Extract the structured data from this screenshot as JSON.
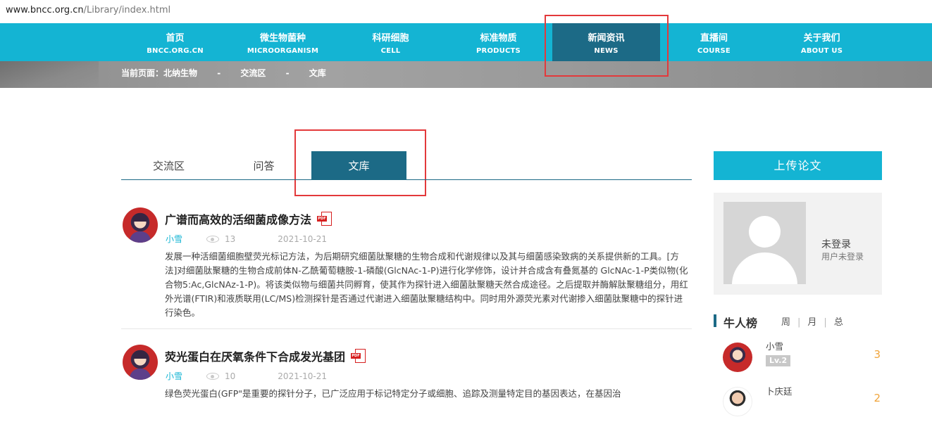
{
  "browser": {
    "url_host": "www.bncc.org.cn",
    "url_path": "/Library/index.html"
  },
  "nav": [
    {
      "cn": "首页",
      "en": "BNCC.ORG.CN"
    },
    {
      "cn": "微生物菌种",
      "en": "MICROORGANISM"
    },
    {
      "cn": "科研细胞",
      "en": "CELL"
    },
    {
      "cn": "标准物质",
      "en": "PRODUCTS"
    },
    {
      "cn": "新闻资讯",
      "en": "NEWS"
    },
    {
      "cn": "直播间",
      "en": "COURSE"
    },
    {
      "cn": "关于我们",
      "en": "ABOUT US"
    }
  ],
  "breadcrumb": {
    "label": "当前页面：北纳生物",
    "sep": "-",
    "item1": "交流区",
    "item2": "文库"
  },
  "tabs": [
    "交流区",
    "问答",
    "文库"
  ],
  "articles": [
    {
      "title": "广谱而高效的活细菌成像方法",
      "file_icon": "PDF",
      "author": "小雪",
      "views": "13",
      "date": "2021-10-21",
      "summary": "发展一种活细菌细胞壁荧光标记方法，为后期研究细菌肽聚糖的生物合成和代谢规律以及其与细菌感染致病的关系提供新的工具。[方法]对细菌肽聚糖的生物合成前体N-乙酰葡萄糖胺-1-磷酸(GlcNAc-1-P)进行化学修饰，设计并合成含有叠氮基的 GlcNAc-1-P类似物(化合物5:Ac,GlcNAz-1-P)。将该类似物与细菌共同孵育，使其作为探针进入细菌肽聚糖天然合成途径。之后提取并酶解肽聚糖组分，用红外光谱(FTIR)和液质联用(LC/MS)检测探针是否通过代谢进入细菌肽聚糖结构中。同时用外源荧光素对代谢掺入细菌肽聚糖中的探针进行染色。"
    },
    {
      "title": "荧光蛋白在厌氧条件下合成发光基团",
      "file_icon": "PDF",
      "author": "小雪",
      "views": "10",
      "date": "2021-10-21",
      "summary": "绿色荧光蛋白(GFP\"是重要的探针分子，已广泛应用于标记特定分子或细胞、追踪及测量特定目的基因表达，在基因治"
    }
  ],
  "sidebar": {
    "upload_label": "上传论文",
    "user_status": "未登录",
    "user_sub": "用户未登录",
    "rank_title": "牛人榜",
    "rank_tabs": [
      "周",
      "月",
      "总"
    ],
    "rank_sep": "|",
    "ranks": [
      {
        "name": "小雪",
        "level": "Lv.2",
        "score": "3"
      },
      {
        "name": "卜庆廷",
        "level": "",
        "score": "2"
      }
    ]
  }
}
